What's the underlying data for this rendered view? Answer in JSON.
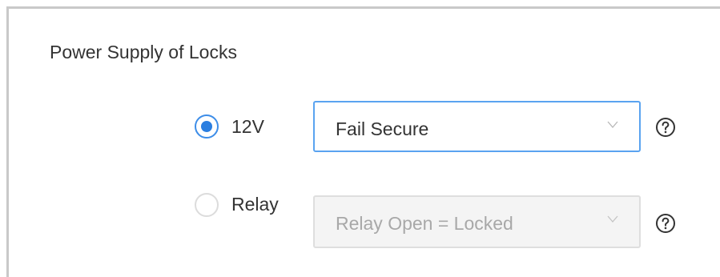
{
  "section": {
    "title": "Power Supply of Locks"
  },
  "options": [
    {
      "label": "12V",
      "selected": true,
      "dropdown_value": "Fail Secure",
      "dropdown_enabled": true
    },
    {
      "label": "Relay",
      "selected": false,
      "dropdown_value": "Relay Open = Locked",
      "dropdown_enabled": false
    }
  ],
  "icons": {
    "radio_selected": "radio-checked-icon",
    "radio_unselected": "radio-unchecked-icon",
    "chevron": "chevron-down-icon",
    "help": "question-circle-icon"
  },
  "colors": {
    "accent": "#2b7ee0",
    "focus_border": "#5aa3f0",
    "disabled_bg": "#f4f4f4",
    "disabled_text": "#a8a8a8"
  }
}
